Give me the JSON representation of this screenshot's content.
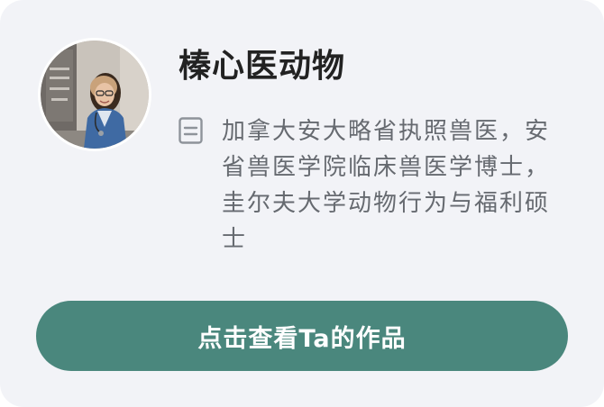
{
  "profile": {
    "name": "榛心医动物",
    "avatar_alt": "avatar",
    "bio": "加拿大安大略省执照兽医，安省兽医学院临床兽医学博士，圭尔夫大学动物行为与福利硕士"
  },
  "actions": {
    "view_works_label": "点击查看Ta的作品"
  },
  "colors": {
    "card_background": "#f2f3f7",
    "button_background": "#4a877d",
    "name_text": "#222222",
    "bio_text": "#666a70"
  },
  "icons": {
    "bio_icon": "document-icon"
  }
}
